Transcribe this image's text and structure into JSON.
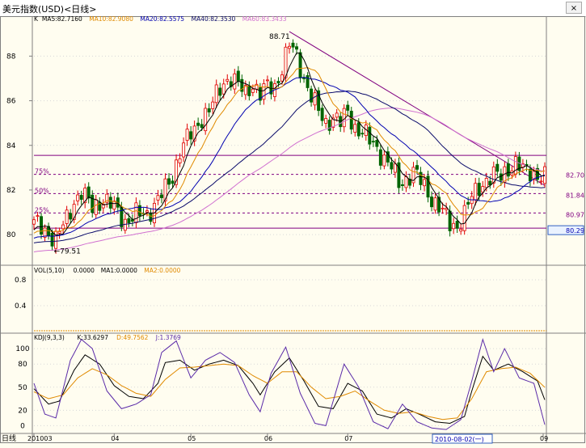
{
  "window": {
    "title": "美元指数(USD)<日线>",
    "close_label": "×"
  },
  "price_panel": {
    "legend": [
      {
        "text": "K",
        "color": "#000000"
      },
      {
        "text": "MA5:82.7160",
        "color": "#000000"
      },
      {
        "text": "MA10:82.9080",
        "color": "#e08a00"
      },
      {
        "text": "MA20:82.5575",
        "color": "#0000b0"
      },
      {
        "text": "MA40:82.3530",
        "color": "#0a0a6a"
      },
      {
        "text": "MA60:83.3433",
        "color": "#d070d0"
      }
    ],
    "y_ticks": [
      80,
      82,
      84,
      86,
      88
    ],
    "high_label": "88.71",
    "low_label": "←79.51",
    "fib_left": [
      "75%",
      "50%",
      "25%"
    ],
    "fib_right": [
      "82.70",
      "81.84",
      "80.97",
      "80.29"
    ],
    "current_value": "80.29"
  },
  "volume_panel": {
    "legend": [
      {
        "text": "VOL(5,10)",
        "color": "#000000"
      },
      {
        "text": "0.0000",
        "color": "#000000"
      },
      {
        "text": "MA1:0.0000",
        "color": "#000000"
      },
      {
        "text": "MA2:0.0000",
        "color": "#e08a00"
      }
    ],
    "y_ticks": [
      "0.8",
      "0.4"
    ]
  },
  "kdj_panel": {
    "legend": [
      {
        "text": "KDJ(9,3,3)",
        "color": "#000000"
      },
      {
        "text": "K:33.6297",
        "color": "#000000"
      },
      {
        "text": "D:49.7562",
        "color": "#e08a00"
      },
      {
        "text": "J:1.3769",
        "color": "#5a2aa8"
      }
    ],
    "y_ticks": [
      100,
      80,
      50,
      20,
      0
    ]
  },
  "x_axis": {
    "labels": [
      "日线",
      "201003",
      "04",
      "05",
      "06",
      "07",
      "08",
      "09"
    ],
    "cursor_label": "2010-08-02(一)"
  },
  "colors": {
    "up": "#e00000",
    "down": "#006400",
    "ma5": "#000000",
    "ma10": "#e08a00",
    "ma20": "#0000b0",
    "ma40": "#0a0a6a",
    "ma60": "#d070d0",
    "fib": "#800080",
    "trend": "#800080",
    "k": "#000000",
    "d": "#e08a00",
    "j": "#5a2aa8"
  },
  "chart_data": [
    {
      "type": "candlestick",
      "title": "美元指数(USD)<日线>",
      "x_range": [
        "2010-03-01",
        "2010-09-03"
      ],
      "ylim": [
        78.7,
        89.5
      ],
      "high": 88.71,
      "low": 79.51,
      "fib_levels": {
        "75%": 82.7,
        "50%": 81.84,
        "25%": 80.97,
        "low": 80.29,
        "high": 83.55
      },
      "close_anchors": [
        [
          0,
          80.5
        ],
        [
          3,
          80.2
        ],
        [
          6,
          79.8
        ],
        [
          9,
          80.7
        ],
        [
          11,
          81.5
        ],
        [
          13,
          81.9
        ],
        [
          16,
          81.2
        ],
        [
          19,
          81.6
        ],
        [
          22,
          81.2
        ],
        [
          25,
          80.6
        ],
        [
          28,
          80.9
        ],
        [
          31,
          80.9
        ],
        [
          34,
          81.6
        ],
        [
          36,
          82.0
        ],
        [
          38,
          82.6
        ],
        [
          40,
          83.8
        ],
        [
          42,
          84.3
        ],
        [
          44,
          84.6
        ],
        [
          46,
          85.3
        ],
        [
          48,
          85.6
        ],
        [
          50,
          86.2
        ],
        [
          52,
          86.8
        ],
        [
          54,
          87.1
        ],
        [
          56,
          86.7
        ],
        [
          58,
          86.3
        ],
        [
          60,
          86.8
        ],
        [
          62,
          86.3
        ],
        [
          64,
          86.6
        ],
        [
          66,
          86.6
        ],
        [
          68,
          87.5
        ],
        [
          70,
          88.5
        ],
        [
          72,
          88.0
        ],
        [
          74,
          87.0
        ],
        [
          76,
          86.2
        ],
        [
          78,
          85.5
        ],
        [
          80,
          85.0
        ],
        [
          82,
          85.3
        ],
        [
          84,
          85.0
        ],
        [
          86,
          85.5
        ],
        [
          88,
          84.8
        ],
        [
          90,
          84.6
        ],
        [
          92,
          84.2
        ],
        [
          94,
          83.9
        ],
        [
          96,
          83.4
        ],
        [
          98,
          83.0
        ],
        [
          100,
          82.3
        ],
        [
          102,
          82.5
        ],
        [
          104,
          82.8
        ],
        [
          106,
          82.4
        ],
        [
          108,
          81.9
        ],
        [
          110,
          81.4
        ],
        [
          112,
          81.0
        ],
        [
          114,
          80.5
        ],
        [
          116,
          80.4
        ],
        [
          118,
          80.9
        ],
        [
          120,
          81.7
        ],
        [
          122,
          82.2
        ],
        [
          124,
          82.4
        ],
        [
          126,
          82.6
        ],
        [
          128,
          82.7
        ],
        [
          130,
          83.0
        ],
        [
          132,
          83.1
        ],
        [
          134,
          82.9
        ],
        [
          136,
          82.9
        ],
        [
          138,
          82.6
        ],
        [
          140,
          82.5
        ]
      ],
      "ma_start": {
        "ma5": 80.1,
        "ma10": 80.0,
        "ma20": 79.8,
        "ma40": 79.6,
        "ma60": 79.2
      },
      "ma_last": {
        "ma5": 82.716,
        "ma10": 82.908,
        "ma20": 82.5575,
        "ma40": 82.353,
        "ma60": 83.3433
      }
    },
    {
      "type": "bar",
      "title": "VOL(5,10)",
      "values": [
        0
      ],
      "ylim": [
        0,
        1.0
      ]
    },
    {
      "type": "line",
      "title": "KDJ(9,3,3)",
      "ylim": [
        -8,
        118
      ],
      "series": [
        {
          "name": "K",
          "anchors": [
            [
              0,
              48
            ],
            [
              4,
              28
            ],
            [
              7,
              32
            ],
            [
              11,
              72
            ],
            [
              14,
              92
            ],
            [
              18,
              80
            ],
            [
              22,
              52
            ],
            [
              26,
              38
            ],
            [
              30,
              35
            ],
            [
              34,
              55
            ],
            [
              36,
              82
            ],
            [
              40,
              85
            ],
            [
              44,
              72
            ],
            [
              48,
              80
            ],
            [
              52,
              85
            ],
            [
              56,
              78
            ],
            [
              60,
              55
            ],
            [
              62,
              40
            ],
            [
              66,
              70
            ],
            [
              70,
              88
            ],
            [
              74,
              58
            ],
            [
              78,
              25
            ],
            [
              82,
              22
            ],
            [
              86,
              55
            ],
            [
              90,
              45
            ],
            [
              94,
              15
            ],
            [
              98,
              10
            ],
            [
              102,
              22
            ],
            [
              106,
              14
            ],
            [
              110,
              5
            ],
            [
              114,
              3
            ],
            [
              118,
              12
            ],
            [
              120,
              45
            ],
            [
              123,
              90
            ],
            [
              126,
              72
            ],
            [
              130,
              80
            ],
            [
              134,
              70
            ],
            [
              138,
              58
            ],
            [
              140,
              33.6297
            ]
          ]
        },
        {
          "name": "D",
          "anchors": [
            [
              0,
              44
            ],
            [
              4,
              35
            ],
            [
              8,
              40
            ],
            [
              12,
              62
            ],
            [
              16,
              74
            ],
            [
              20,
              66
            ],
            [
              24,
              52
            ],
            [
              28,
              42
            ],
            [
              32,
              38
            ],
            [
              36,
              60
            ],
            [
              40,
              75
            ],
            [
              44,
              76
            ],
            [
              48,
              78
            ],
            [
              52,
              80
            ],
            [
              56,
              78
            ],
            [
              60,
              65
            ],
            [
              64,
              55
            ],
            [
              68,
              70
            ],
            [
              72,
              70
            ],
            [
              76,
              50
            ],
            [
              80,
              35
            ],
            [
              84,
              38
            ],
            [
              88,
              45
            ],
            [
              92,
              32
            ],
            [
              96,
              20
            ],
            [
              100,
              16
            ],
            [
              104,
              18
            ],
            [
              108,
              12
            ],
            [
              112,
              8
            ],
            [
              116,
              10
            ],
            [
              120,
              35
            ],
            [
              124,
              70
            ],
            [
              128,
              74
            ],
            [
              132,
              76
            ],
            [
              136,
              68
            ],
            [
              140,
              49.7562
            ]
          ]
        },
        {
          "name": "J",
          "anchors": [
            [
              0,
              55
            ],
            [
              3,
              15
            ],
            [
              6,
              10
            ],
            [
              10,
              85
            ],
            [
              13,
              112
            ],
            [
              16,
              100
            ],
            [
              20,
              45
            ],
            [
              24,
              22
            ],
            [
              28,
              28
            ],
            [
              32,
              40
            ],
            [
              35,
              95
            ],
            [
              39,
              110
            ],
            [
              43,
              62
            ],
            [
              47,
              85
            ],
            [
              51,
              95
            ],
            [
              55,
              82
            ],
            [
              59,
              40
            ],
            [
              62,
              18
            ],
            [
              65,
              68
            ],
            [
              69,
              102
            ],
            [
              73,
              42
            ],
            [
              77,
              3
            ],
            [
              80,
              0
            ],
            [
              85,
              80
            ],
            [
              89,
              50
            ],
            [
              93,
              5
            ],
            [
              97,
              -4
            ],
            [
              101,
              28
            ],
            [
              105,
              5
            ],
            [
              109,
              -3
            ],
            [
              113,
              -5
            ],
            [
              117,
              8
            ],
            [
              120,
              58
            ],
            [
              123,
              112
            ],
            [
              126,
              70
            ],
            [
              129,
              100
            ],
            [
              133,
              62
            ],
            [
              137,
              55
            ],
            [
              140,
              1.3769
            ]
          ]
        }
      ]
    }
  ]
}
